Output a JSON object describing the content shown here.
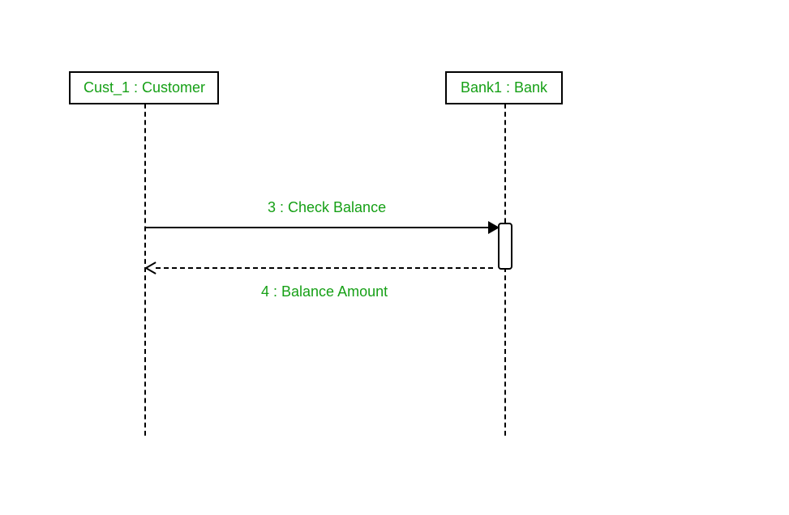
{
  "diagram": {
    "type": "sequence-diagram",
    "lifelines": [
      {
        "name": "Cust_1",
        "type": "Customer",
        "label": "Cust_1 : Customer"
      },
      {
        "name": "Bank1",
        "type": "Bank",
        "label": "Bank1 : Bank"
      }
    ],
    "messages": [
      {
        "seq": 3,
        "label": "3 : Check Balance",
        "from": "Cust_1",
        "to": "Bank1",
        "style": "sync"
      },
      {
        "seq": 4,
        "label": "4 : Balance Amount",
        "from": "Bank1",
        "to": "Cust_1",
        "style": "return"
      }
    ]
  }
}
